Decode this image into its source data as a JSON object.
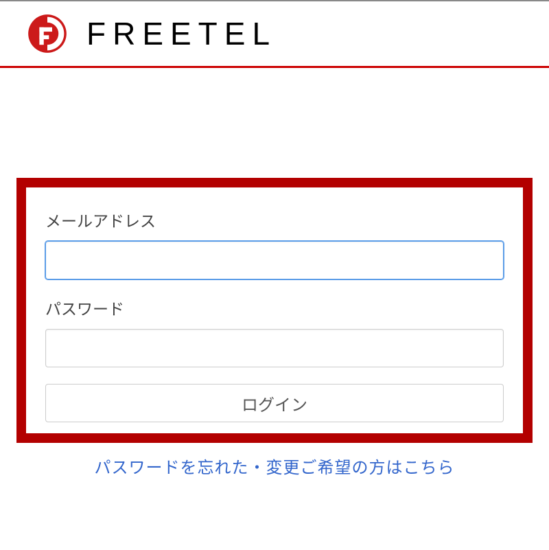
{
  "brand": {
    "name": "FREETEL",
    "accent_color": "#cc0000",
    "border_color": "#b30000"
  },
  "login": {
    "email_label": "メールアドレス",
    "email_value": "",
    "password_label": "パスワード",
    "password_value": "",
    "submit_label": "ログイン"
  },
  "links": {
    "forgot_password": "パスワードを忘れた・変更ご希望の方はこちら"
  }
}
